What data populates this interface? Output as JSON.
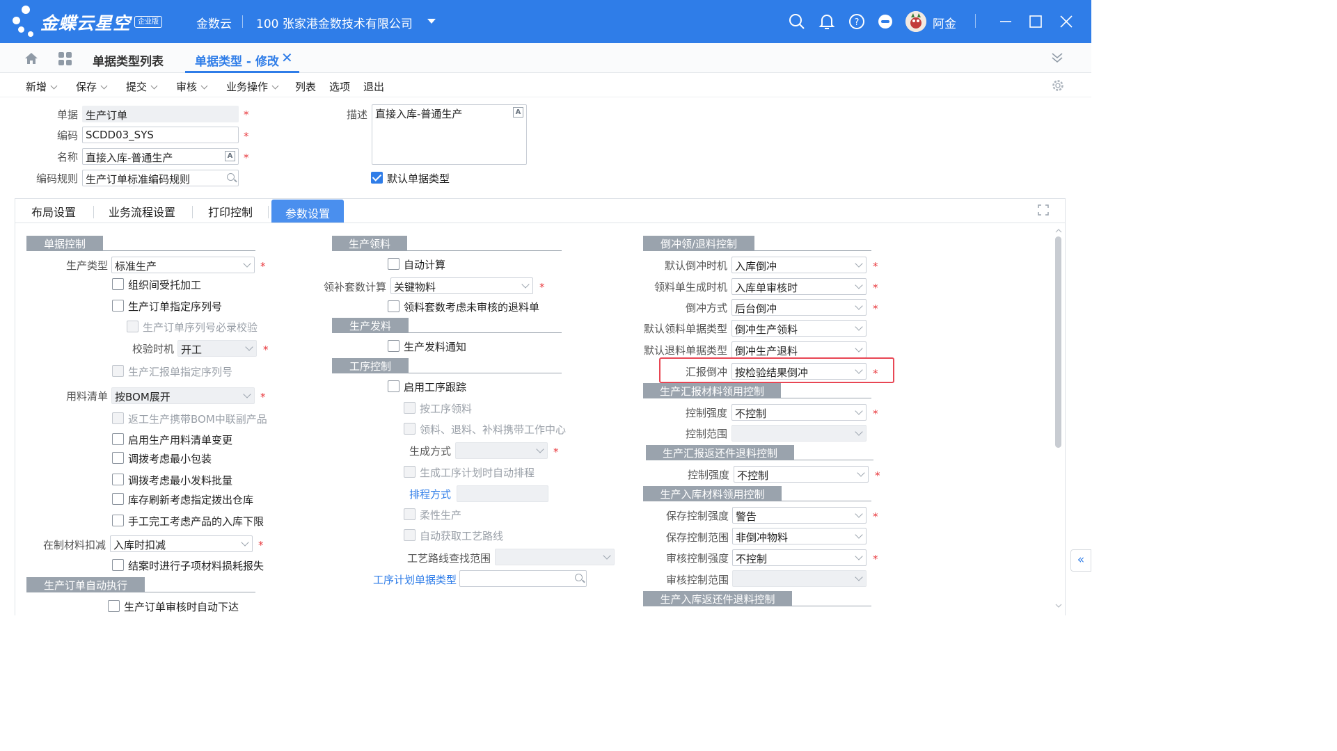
{
  "header": {
    "logo_text": "金蝶云星空",
    "logo_badge": "企业版",
    "app_name": "金数云",
    "org": "100   张家港金数技术有限公司",
    "username": "阿金",
    "brand_color": "#2f7de8"
  },
  "tabs": {
    "list_tab": "单据类型列表",
    "active_tab": "单据类型 - 修改",
    "close_glyph": "✕"
  },
  "toolbar": {
    "items": [
      "新增",
      "保存",
      "提交",
      "审核",
      "业务操作",
      "列表",
      "选项",
      "退出"
    ]
  },
  "header_form": {
    "bill_label": "单据",
    "bill_value": "生产订单",
    "code_label": "编码",
    "code_value": "SCDD03_SYS",
    "name_label": "名称",
    "name_value": "直接入库-普通生产",
    "rule_label": "编码规则",
    "rule_value": "生产订单标准编码规则",
    "desc_label": "描述",
    "desc_value": "直接入库-普通生产",
    "default_type_label": "默认单据类型",
    "default_type_checked": true,
    "multilang_glyph": "A",
    "required_mark": "*"
  },
  "panel_tabs": [
    "布局设置",
    "业务流程设置",
    "打印控制",
    "参数设置"
  ],
  "col1": {
    "sec_bill_control": "单据控制",
    "prod_type_label": "生产类型",
    "prod_type_value": "标准生产",
    "cb_outsource": "组织间受托加工",
    "cb_seq_no": "生产订单指定序列号",
    "cb_seq_required": "生产订单序列号必录校验",
    "check_time_label": "校验时机",
    "check_time_value": "开工",
    "cb_report_seq": "生产汇报单指定序列号",
    "bom_label": "用料清单",
    "bom_value": "按BOM展开",
    "cb_rework": "返工生产携带BOM中联副产品",
    "cb_bom_change": "启用生产用料清单变更",
    "cb_min_pack": "调拨考虑最小包装",
    "cb_min_batch": "调拨考虑最小发料批量",
    "cb_stock_refresh": "库存刷新考虑指定拨出仓库",
    "cb_manual_finish": "手工完工考虑产品的入库下限",
    "wip_label": "在制材料扣减",
    "wip_value": "入库时扣减",
    "cb_close_loss": "结案时进行子项材料损耗报失",
    "sec_auto_exec": "生产订单自动执行",
    "cb_auto_release": "生产订单审核时自动下达"
  },
  "col2": {
    "sec_issue": "生产领料",
    "cb_auto_calc": "自动计算",
    "kit_label": "领补套数计算",
    "kit_value": "关键物料",
    "cb_kit_unaudited": "领料套数考虑未审核的退料单",
    "sec_dispatch": "生产发料",
    "cb_dispatch_notice": "生产发料通知",
    "sec_process": "工序控制",
    "cb_enable_track": "启用工序跟踪",
    "cb_by_process": "按工序领料",
    "cb_carry_wc": "领料、退料、补料携带工作中心",
    "gen_mode_label": "生成方式",
    "cb_auto_schedule": "生成工序计划时自动排程",
    "schedule_mode_link": "排程方式",
    "cb_flexible": "柔性生产",
    "cb_auto_route": "自动获取工艺路线",
    "route_scope_label": "工艺路线查找范围",
    "plan_type_link": "工序计划单据类型"
  },
  "col3": {
    "sec_backflush": "倒冲领/退料控制",
    "default_time_label": "默认倒冲时机",
    "default_time_value": "入库倒冲",
    "gen_time_label": "领料单生成时机",
    "gen_time_value": "入库单审核时",
    "bf_mode_label": "倒冲方式",
    "bf_mode_value": "后台倒冲",
    "issue_type_label": "默认领料单据类型",
    "issue_type_value": "倒冲生产领料",
    "return_type_label": "默认退料单据类型",
    "return_type_value": "倒冲生产退料",
    "report_bf_label": "汇报倒冲",
    "report_bf_value": "按检验结果倒冲",
    "sec_report_material": "生产汇报材料领用控制",
    "ctrl_strength_label": "控制强度",
    "ctrl_strength_value": "不控制",
    "ctrl_scope_label": "控制范围",
    "sec_report_return": "生产汇报返还件退料控制",
    "ctrl_strength2_label": "控制强度",
    "ctrl_strength2_value": "不控制",
    "sec_instock_material": "生产入库材料领用控制",
    "save_strength_label": "保存控制强度",
    "save_strength_value": "警告",
    "save_scope_label": "保存控制范围",
    "save_scope_value": "非倒冲物料",
    "audit_strength_label": "审核控制强度",
    "audit_strength_value": "不控制",
    "audit_scope_label": "审核控制范围",
    "sec_instock_return": "生产入库返还件退料控制"
  },
  "colors": {
    "highlight": "#e84654",
    "section_bg": "#9aa3ad",
    "required": "#e8383d"
  }
}
